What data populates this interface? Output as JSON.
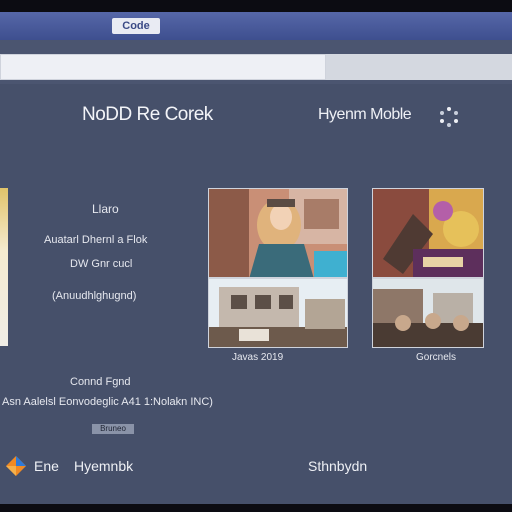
{
  "window": {
    "tab_label": "Code"
  },
  "address": {
    "value": ""
  },
  "brand": {
    "left": "NoDD Re Corek",
    "right": "Hyenm Moble"
  },
  "middle": {
    "title": "Llaro",
    "line1": "Auatarl Dhernl a Flok",
    "line2": "DW Gnr cucl",
    "line3": "(Anuudhlghugnd)"
  },
  "gallery": {
    "caption_left": "Javas 2019",
    "caption_right": "Gorcnels"
  },
  "footer": {
    "heading": "Connd Fgnd",
    "line": "Asn Aalelsl Eonvodeglic A41 1:Nolakn INC)",
    "badge": "Bruneo"
  },
  "bottom": {
    "left1": "Ene",
    "left2": "Hyemnbk",
    "right": "Sthnbydn"
  },
  "colors": {
    "titlebar": "#4a5b9b",
    "content_bg": "#46506a",
    "text": "#eef0f5"
  },
  "icons": {
    "brand": "dots-icon",
    "app": "app-logo-icon"
  }
}
